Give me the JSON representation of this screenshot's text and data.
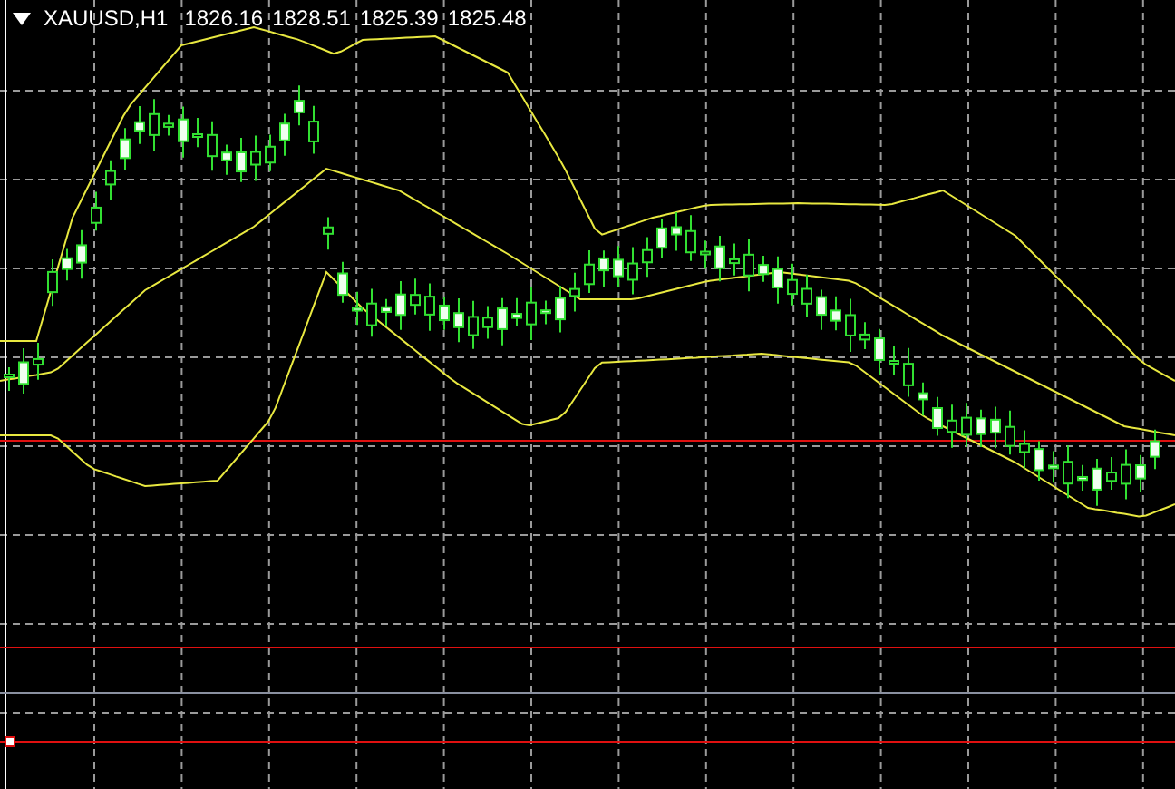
{
  "chart": {
    "symbol": "XAUUSD,H1",
    "quotes": [
      "1826.16",
      "1828.51",
      "1825.39",
      "1825.48"
    ]
  }
}
